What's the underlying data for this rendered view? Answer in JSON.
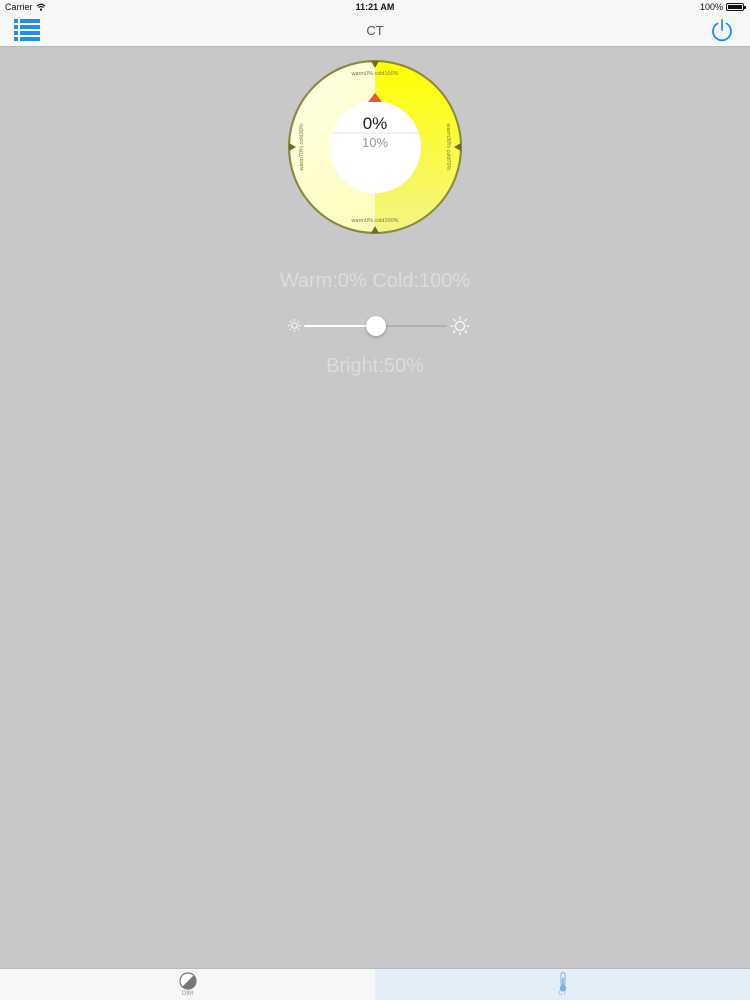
{
  "status_bar": {
    "carrier": "Carrier",
    "time": "11:21 AM",
    "battery": "100%",
    "icons": [
      "wifi-icon",
      "battery-icon"
    ]
  },
  "nav": {
    "title": "CT",
    "left_icon": "list-menu-icon",
    "right_icon": "power-icon",
    "accent_color": "#1e8cf0"
  },
  "dial": {
    "value": "0%",
    "sub_value": "10%",
    "ring_labels": [
      "warm0% cold100%",
      "warm30% cold70%",
      "warm0% cold100%",
      "warm70% cold30%"
    ],
    "colors": {
      "ring_border": "#8a8a3a",
      "warm_fill": "#ffff00",
      "cold_fill": "#fdfdf0",
      "indicator": "#e05a3a"
    }
  },
  "color_temp_label": "Warm:0% Cold:100%",
  "brightness": {
    "value_fraction": 0.5,
    "label": "Bright:50%",
    "min_icon": "sun-small-icon",
    "max_icon": "sun-large-icon"
  },
  "tabs": [
    {
      "label": "DIM",
      "icon": "dim-icon",
      "active": false
    },
    {
      "label": "CT",
      "icon": "thermometer-icon",
      "active": true
    }
  ]
}
